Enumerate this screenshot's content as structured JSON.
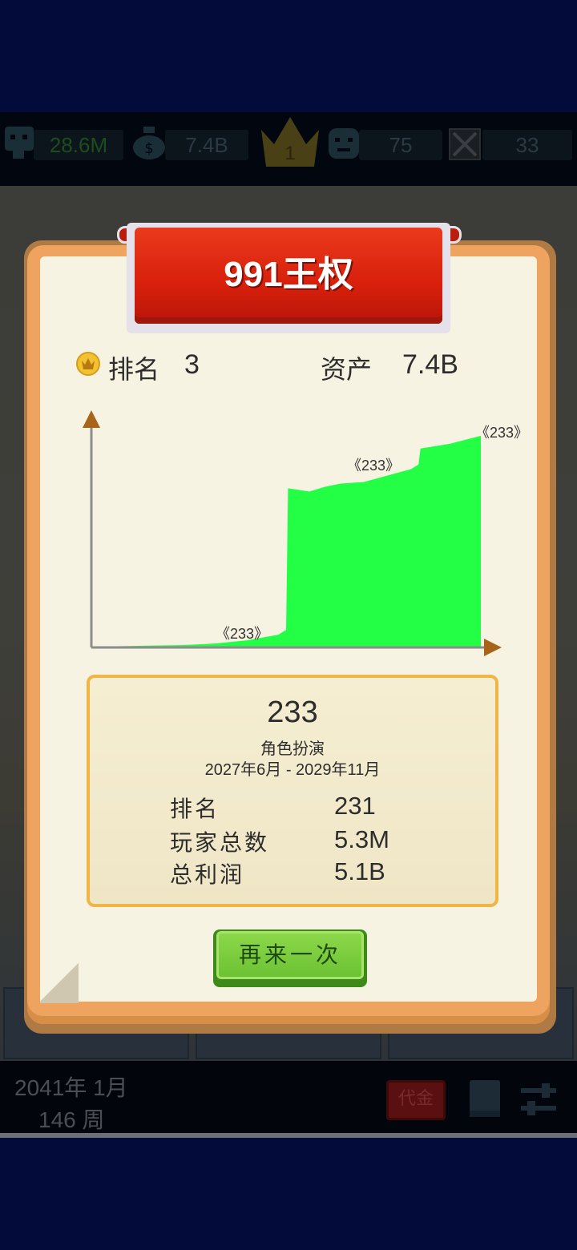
{
  "top_stats": {
    "fans": "28.6M",
    "money": "7.4B",
    "crown_rank": "1",
    "staff": "75",
    "blocked": "33"
  },
  "dialog": {
    "title": "991王权",
    "rank_label": "排名",
    "rank_value": "3",
    "assets_label": "资产",
    "assets_value": "7.4B"
  },
  "chart_data": {
    "type": "area",
    "x": [
      0,
      0.08,
      0.16,
      0.24,
      0.32,
      0.4,
      0.48,
      0.5,
      0.505,
      0.56,
      0.6,
      0.64,
      0.7,
      0.76,
      0.82,
      0.84,
      0.845,
      0.92,
      1.0
    ],
    "values": [
      0.5,
      0.8,
      1.2,
      1.5,
      2.5,
      4.5,
      8,
      11,
      100,
      98,
      101,
      103,
      104,
      108,
      112,
      115,
      125,
      128,
      133
    ],
    "annotations": [
      "《233》",
      "《233》",
      "《233》"
    ],
    "color": "#22ff44",
    "axis_color": "#a86418"
  },
  "info": {
    "game_name": "233",
    "genre": "角色扮演",
    "period": "2027年6月 - 2029年11月",
    "rank_label": "排名",
    "rank_value": "231",
    "players_label": "玩家总数",
    "players_value": "5.3M",
    "profit_label": "总利润",
    "profit_value": "5.1B"
  },
  "retry_button": "再来一次",
  "bottom": {
    "date": "2041年 1月",
    "week": "146 周",
    "badge": "代金"
  },
  "colors": {
    "fans": "#1c4d1c",
    "stat_text": "#2a3a44",
    "crown": "#4a4016"
  }
}
